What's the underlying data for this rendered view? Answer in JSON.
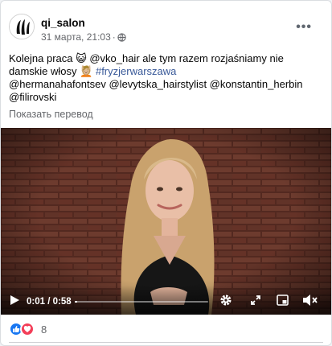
{
  "post": {
    "author": "qi_salon",
    "date": "31 марта, 21:03",
    "separator": "·",
    "text": {
      "part1": "Kolejna praca",
      "emoji1": "😺",
      "part2": "@vko_hair  ale tym razem rozjaśniamy nie damskie włosy",
      "emoji2": "💆🏼",
      "hashtag": "#fryzjerwarszawa",
      "mentions_line1": "@hermanahafontsev  @levytska_hairstylist @konstantin_herbin",
      "mentions_line2": "@filirovski"
    },
    "translate_label": "Показать перевод"
  },
  "video": {
    "timecode": "0:01 / 0:58",
    "progress": 0.02,
    "colors": {
      "brick": "#6b3a2e",
      "hair": "#d9b98a",
      "jacket": "#161616"
    }
  },
  "footer": {
    "reaction_count": "8",
    "like_color": "#1877f2",
    "love_color": "#f33e58"
  },
  "icons": [
    "more-icon",
    "globe-icon",
    "play-icon",
    "settings-icon",
    "fullscreen-icon",
    "miniplayer-icon",
    "volume-icon",
    "like-icon",
    "love-icon"
  ]
}
